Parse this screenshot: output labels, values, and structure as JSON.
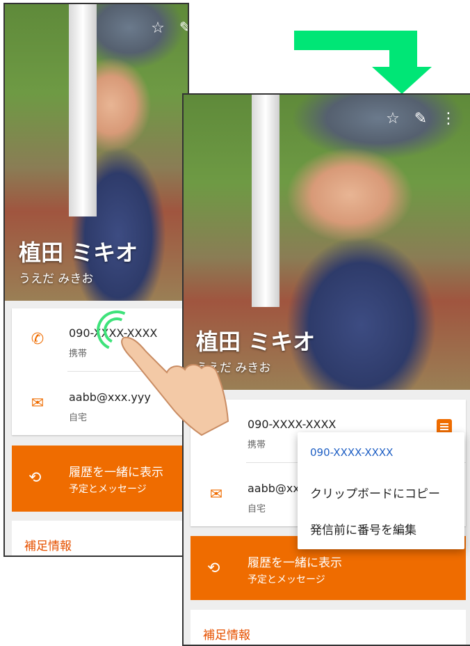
{
  "contact": {
    "name": "植田 ミキオ",
    "kana": "うえだ みきお",
    "phone": "090-XXXX-XXXX",
    "phone_label": "携帯",
    "email": "aabb@xxx.yyy",
    "email_label": "自宅"
  },
  "screen1": {
    "phone_visible": "090-XXXX-XXXX",
    "email_visible": "aabb@xxx.yyy"
  },
  "screen2": {
    "email_partial": "aabb@xx"
  },
  "history": {
    "title": "履歴を一緒に表示",
    "subtitle": "予定とメッセージ"
  },
  "extra_info": "補足情報",
  "popup": {
    "number": "090-XXXX-XXXX",
    "copy": "クリップボードにコピー",
    "edit": "発信前に番号を編集"
  },
  "icons": {
    "star": "star-icon",
    "edit": "edit-icon",
    "more": "more-vert-icon",
    "phone": "phone-icon",
    "email": "email-icon",
    "history": "history-icon",
    "message": "message-icon"
  },
  "colors": {
    "accent": "#ef6c00",
    "tap": "#3ee27a",
    "arrow": "#00e676",
    "link": "#1e5fc4"
  }
}
